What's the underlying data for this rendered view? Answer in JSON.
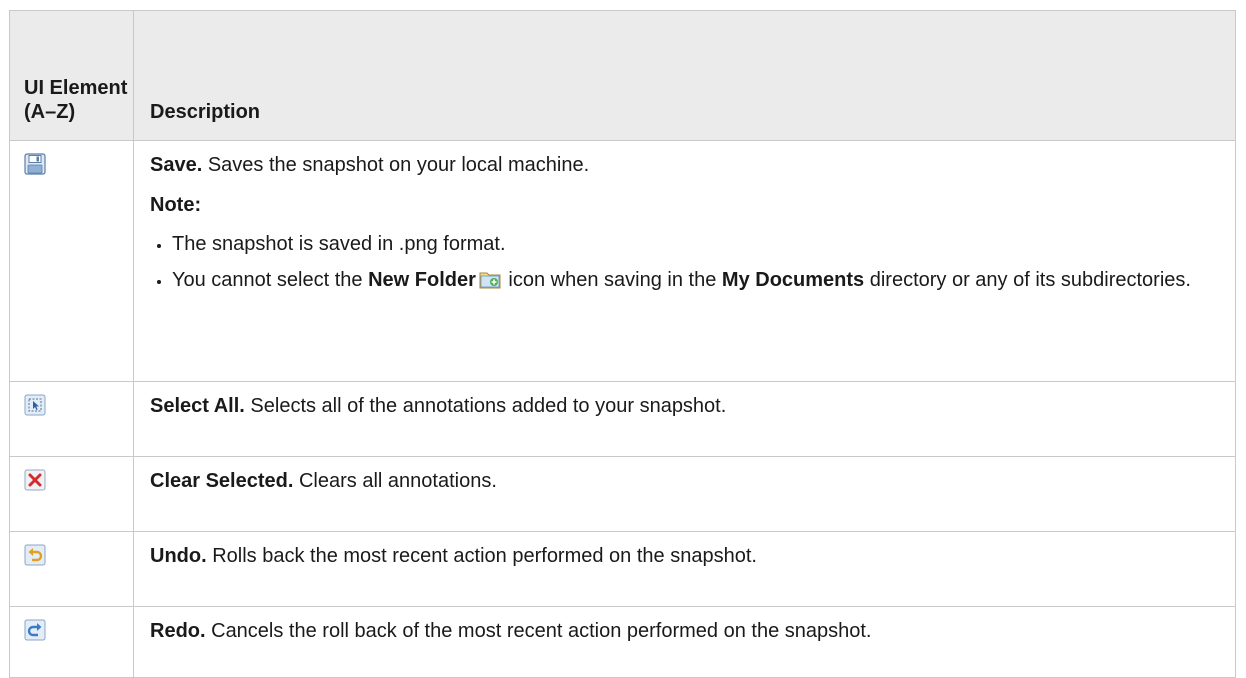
{
  "header": {
    "col1": "UI Element (A–Z)",
    "col2": "Description"
  },
  "rows": [
    {
      "icon": "save-icon",
      "title": "Save.",
      "text": " Saves the snapshot on your local machine.",
      "note_label": "Note:",
      "bullets": {
        "b1": "The snapshot is saved in .png format.",
        "b2_prefix": "You cannot select the ",
        "b2_bold1": "New Folder",
        "b2_mid": " icon when saving in the ",
        "b2_bold2": "My Documents",
        "b2_suffix": " directory or any of its subdirectories."
      }
    },
    {
      "icon": "select-all-icon",
      "title": "Select All.",
      "text": " Selects all of the annotations added to your snapshot."
    },
    {
      "icon": "clear-selected-icon",
      "title": "Clear Selected.",
      "text": " Clears all annotations."
    },
    {
      "icon": "undo-icon",
      "title": "Undo.",
      "text": " Rolls back the most recent action performed on the snapshot."
    },
    {
      "icon": "redo-icon",
      "title": "Redo.",
      "text": " Cancels the roll back of the most recent action performed on the snapshot."
    }
  ],
  "colors": {
    "header_bg": "#ebebeb",
    "border": "#c9c9c9",
    "text": "#1a1a1a"
  }
}
